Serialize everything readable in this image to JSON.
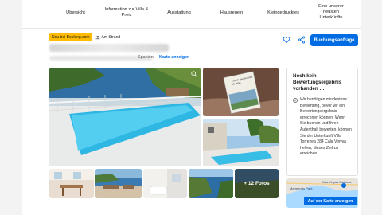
{
  "nav": {
    "items": [
      {
        "label": "Übersicht"
      },
      {
        "label": "Information zur Villa & Preis"
      },
      {
        "label": "Ausstattung"
      },
      {
        "label": "Hausregeln"
      },
      {
        "label": "Kleingedrucktes"
      },
      {
        "label": "Eine unserer neusten Unterkünfte"
      }
    ]
  },
  "badges": {
    "new": "Neu bei Booking.com",
    "beach": "Am Strand"
  },
  "address": {
    "lang": "Spanien",
    "map_link": "Karte anzeigen"
  },
  "actions": {
    "book_label": "Buchungsanfrage"
  },
  "gallery": {
    "more_label": "+ 12 Fotos",
    "book_cover_text": "Lorem Ipsum dolor sit amet"
  },
  "review": {
    "title": "Noch kein Bewertungsergebnis vorhanden …",
    "text": "Wir benötigen mindestens 1 Bewertung, bevor wir ein Bewertungsergebnis errechnen können. Wenn Sie buchen und Ihren Aufenthalt bewerten, können Sie der Unterkunft Villa Torrezea 284 Cala Vinyas helfen, dieses Ziel zu erreichen."
  },
  "map": {
    "button_label": "Auf der Karte anzeigen",
    "label_1": "Marmendu Park",
    "label_2": "Cala Vinyas Mallorca"
  },
  "colors": {
    "brand_blue": "#006ce4",
    "new_badge": "#febb02"
  }
}
